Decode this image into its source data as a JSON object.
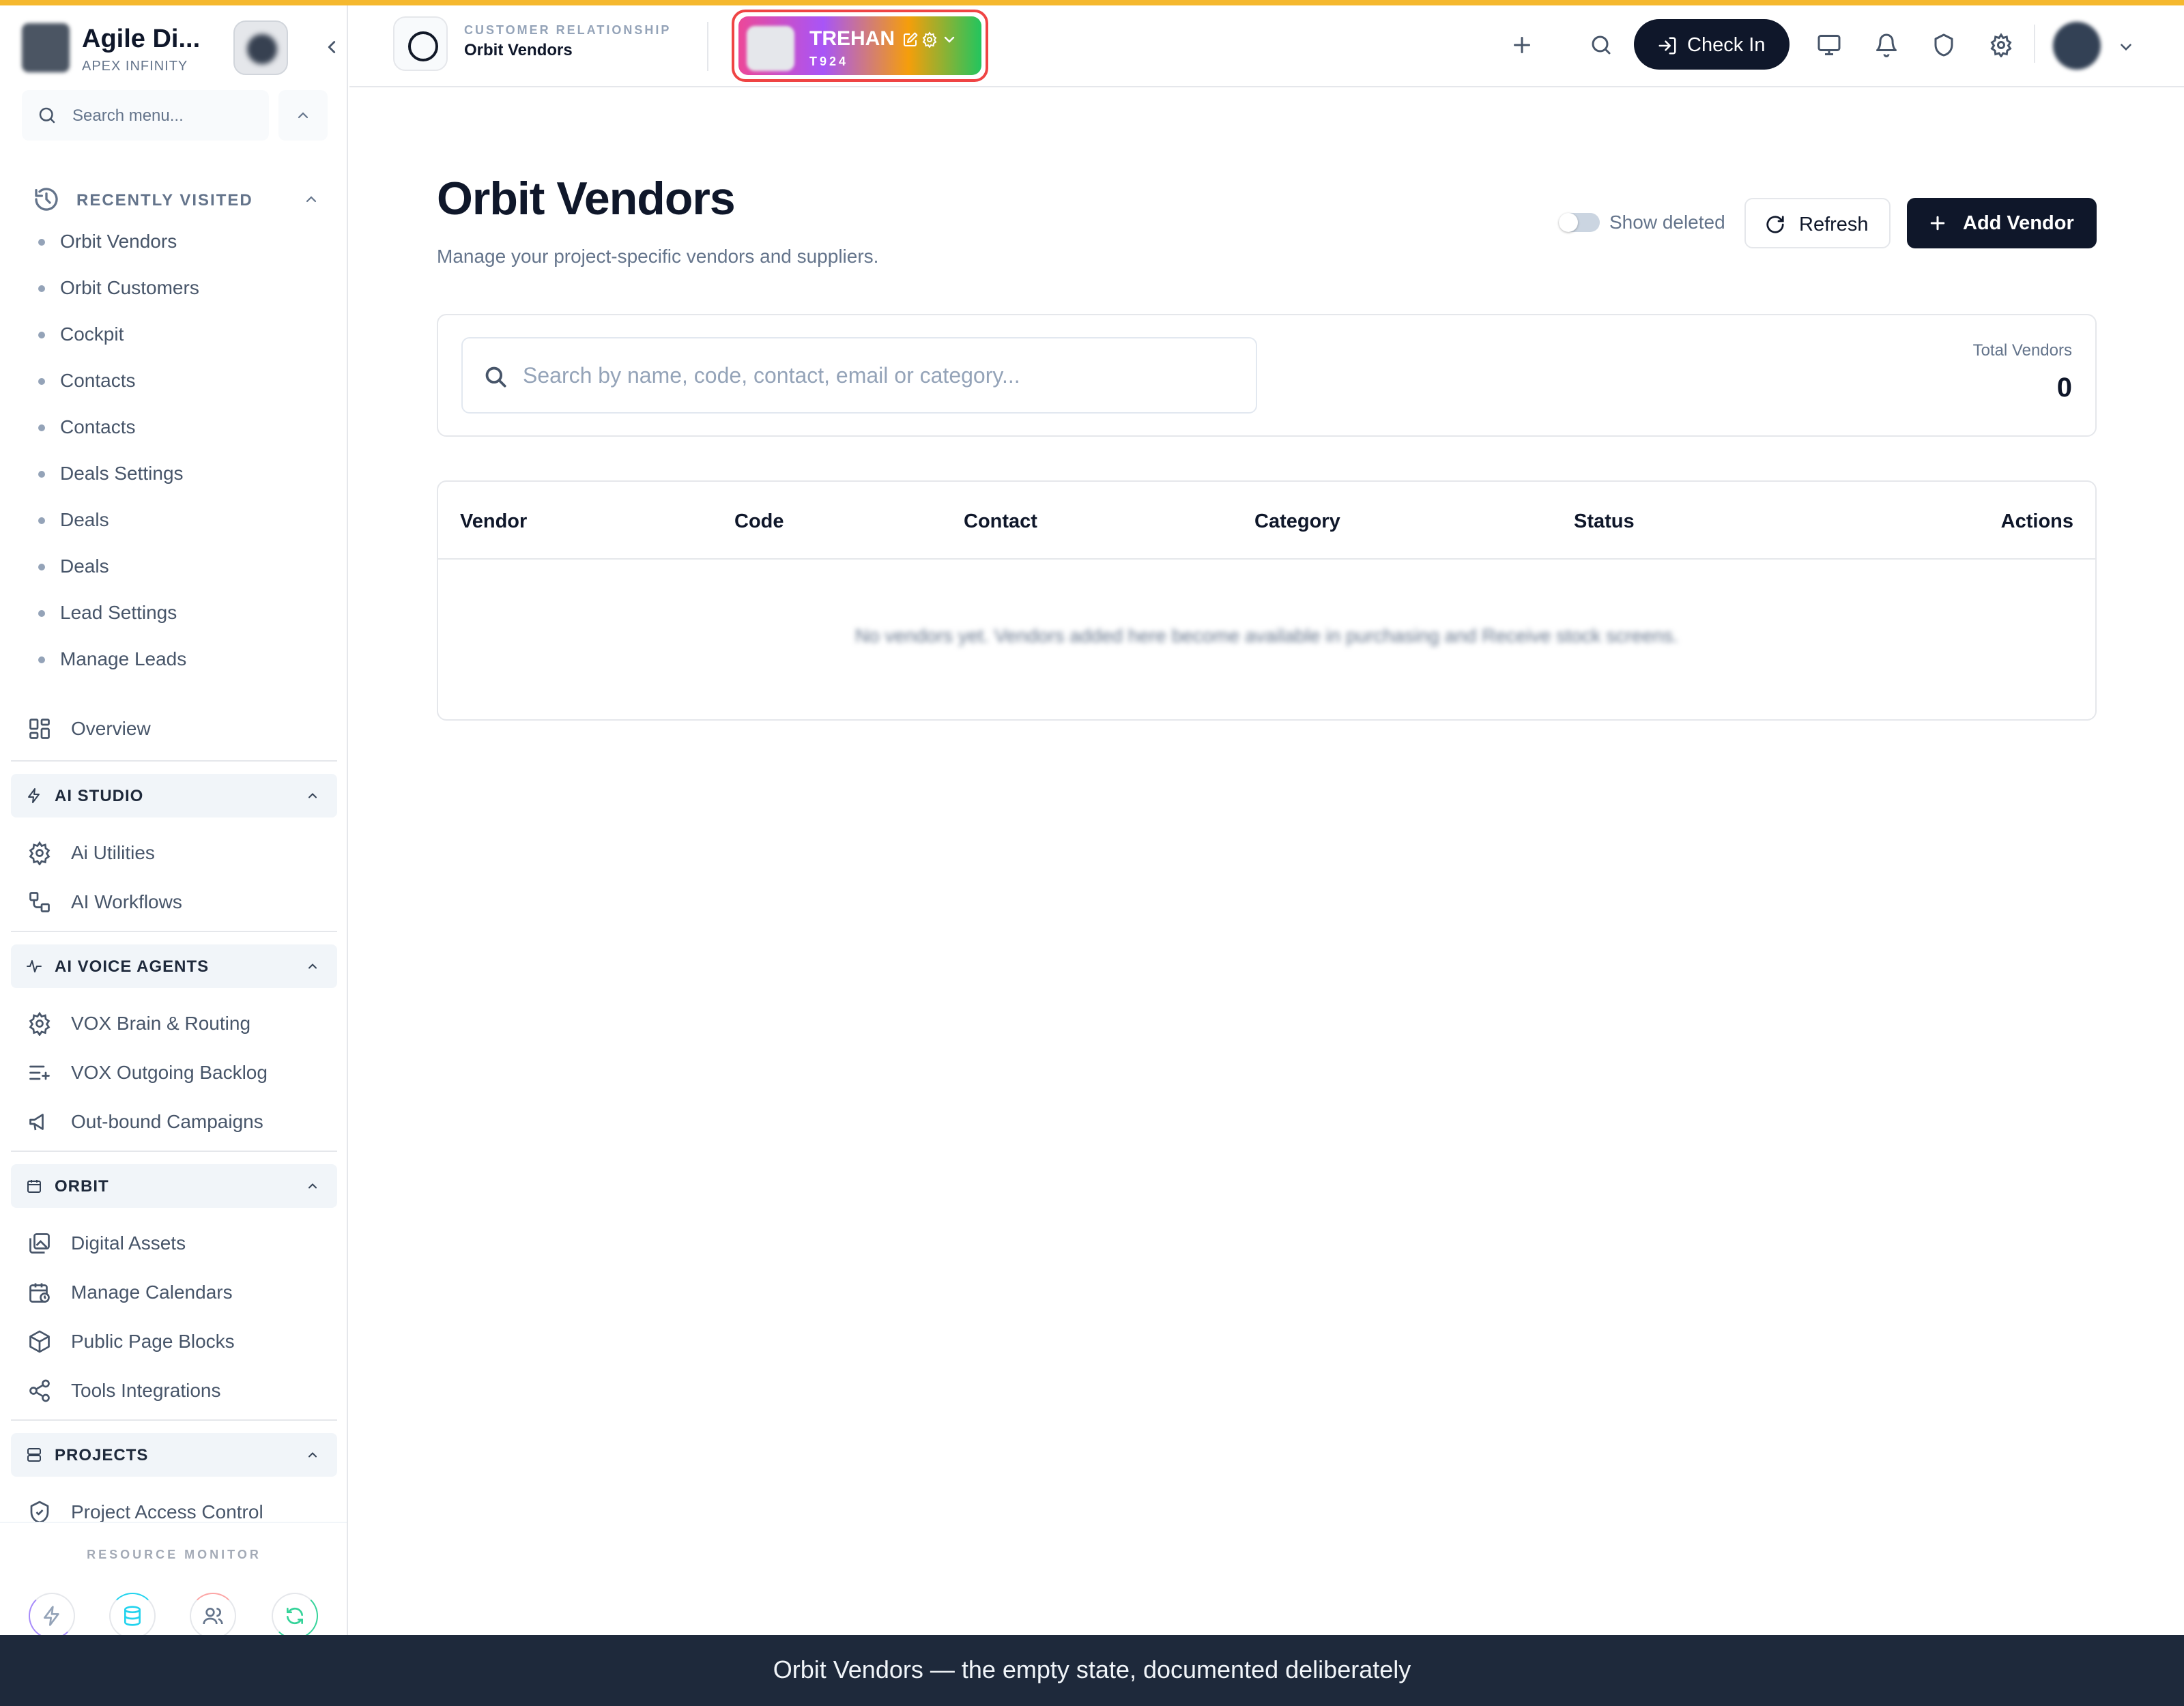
{
  "sidebar": {
    "brand_title": "Agile Di...",
    "brand_subtitle": "APEX INFINITY",
    "search_placeholder": "Search menu...",
    "recently_visited": {
      "title": "RECENTLY VISITED",
      "items": [
        "Orbit Vendors",
        "Orbit Customers",
        "Cockpit",
        "Contacts",
        "Contacts",
        "Deals Settings",
        "Deals",
        "Deals",
        "Lead Settings",
        "Manage Leads"
      ]
    },
    "overview_label": "Overview",
    "sections": [
      {
        "title": "AI STUDIO",
        "items": [
          "Ai Utilities",
          "AI Workflows"
        ]
      },
      {
        "title": "AI VOICE AGENTS",
        "items": [
          "VOX Brain & Routing",
          "VOX Outgoing Backlog",
          "Out-bound Campaigns"
        ]
      },
      {
        "title": "ORBIT",
        "items": [
          "Digital Assets",
          "Manage Calendars",
          "Public Page Blocks",
          "Tools Integrations"
        ]
      },
      {
        "title": "PROJECTS",
        "items": [
          "Project Access Control"
        ]
      }
    ],
    "resource_monitor": "RESOURCE MONITOR"
  },
  "header": {
    "module_category": "CUSTOMER RELATIONSHIP",
    "module_name": "Orbit Vendors",
    "tenant_name": "TREHAN",
    "tenant_code": "T924",
    "checkin_label": "Check In"
  },
  "main": {
    "title": "Orbit Vendors",
    "subtitle": "Manage your project-specific vendors and suppliers.",
    "show_deleted_label": "Show deleted",
    "show_deleted": false,
    "refresh_label": "Refresh",
    "add_label": "Add Vendor",
    "search_placeholder": "Search by name, code, contact, email or category...",
    "total_label": "Total Vendors",
    "total_value": "0",
    "columns": [
      "Vendor",
      "Code",
      "Contact",
      "Category",
      "Status",
      "Actions"
    ],
    "empty_message": "No vendors yet. Vendors added here become available in purchasing and Receive stock screens."
  },
  "caption": "Orbit Vendors — the empty state, documented deliberately",
  "colors": {
    "accent_bar": "#f5b82e",
    "primary_dark": "#0f172a",
    "tenant_border": "#ef4444"
  }
}
